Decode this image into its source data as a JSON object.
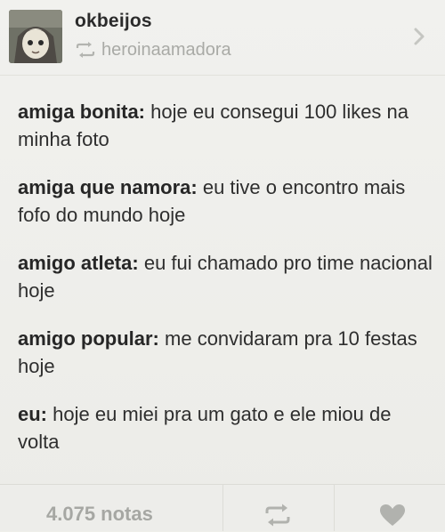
{
  "post": {
    "author": "okbeijos",
    "reblogged_from": "heroinaamadora",
    "lines": [
      {
        "speaker": "amiga bonita:",
        "text": "hoje eu consegui 100 likes na minha foto"
      },
      {
        "speaker": "amiga que namora:",
        "text": "eu tive o encontro mais fofo do mundo hoje"
      },
      {
        "speaker": "amigo atleta:",
        "text": "eu fui chamado pro time nacional hoje"
      },
      {
        "speaker": "amigo popular:",
        "text": "me convidaram pra 10 festas hoje"
      },
      {
        "speaker": "eu:",
        "text": "hoje eu miei pra um gato e ele miou de volta"
      }
    ]
  },
  "footer": {
    "notes_label": "4.075 notas"
  },
  "icons": {
    "reblog_small": "reblog-icon",
    "chevron": "chevron-right-icon",
    "footer_reblog": "reblog-icon",
    "footer_like": "heart-icon"
  },
  "colors": {
    "background": "#efefea",
    "muted_text": "#a9aaa6",
    "main_text": "#2e2e2e"
  }
}
